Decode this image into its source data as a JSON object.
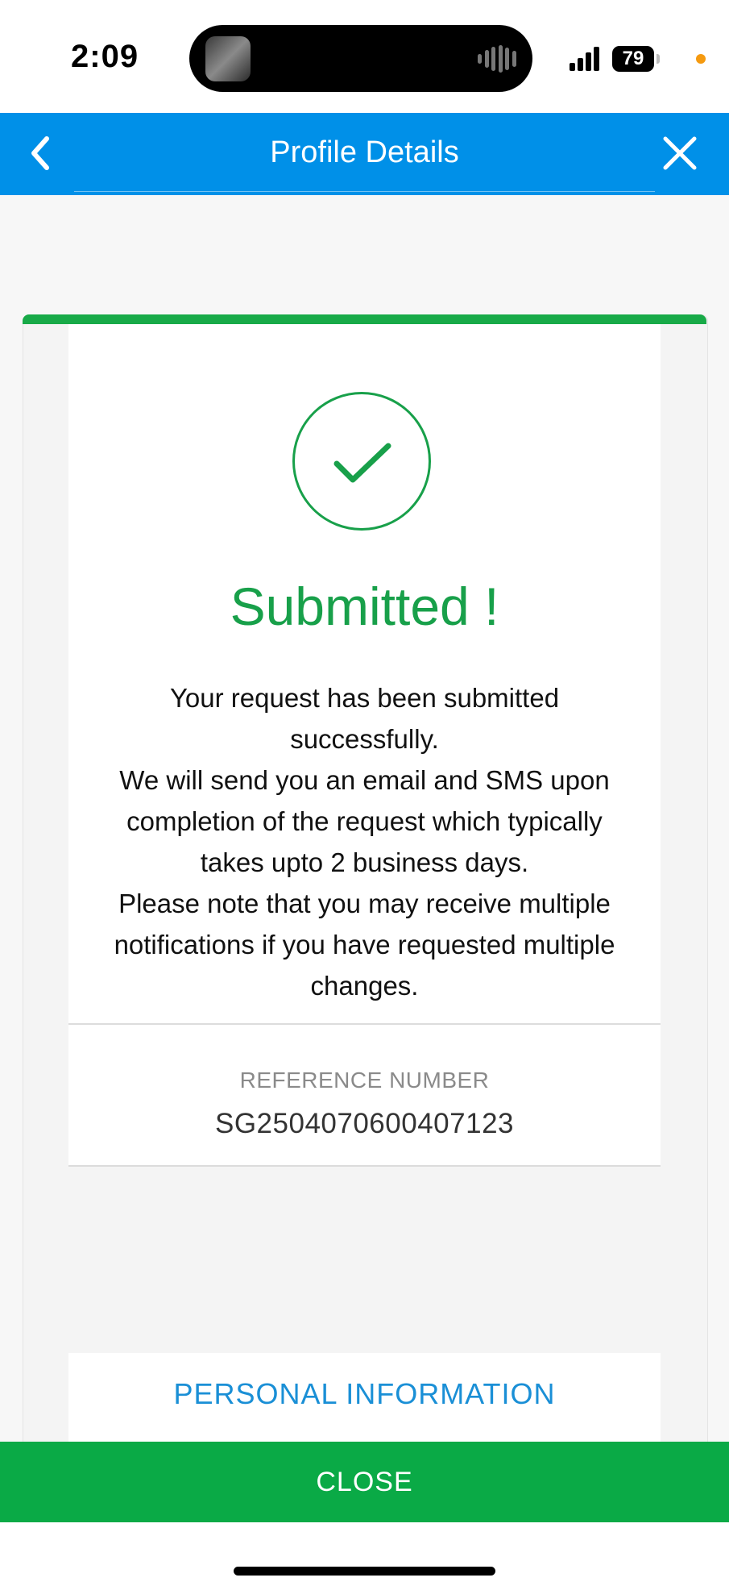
{
  "status_bar": {
    "time": "2:09",
    "battery": "79"
  },
  "header": {
    "title": "Profile Details",
    "back_icon": "chevron-left-icon",
    "close_icon": "close-icon",
    "color": "#0090E8"
  },
  "result": {
    "icon": "check-circle-icon",
    "title": "Submitted !",
    "message_lines": [
      "Your request has been submitted",
      "successfully.",
      "We will send you an email and SMS upon",
      "completion of the request which typically",
      "takes upto 2 business days.",
      "Please note that you may receive multiple",
      "notifications if you have requested multiple",
      "changes."
    ],
    "reference_label": "REFERENCE NUMBER",
    "reference_number": "SG2504070600407123",
    "success_color": "#18A04A"
  },
  "sections": {
    "personal_information_label": "PERSONAL INFORMATION"
  },
  "footer": {
    "close_label": "CLOSE",
    "color": "#0AAA46"
  }
}
